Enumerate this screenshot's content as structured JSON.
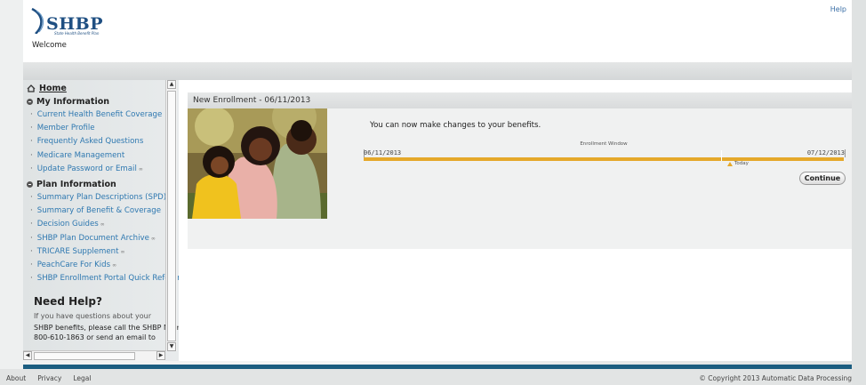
{
  "header": {
    "logo_text": "SHBP",
    "logo_subtitle": "State Health Benefit Plan",
    "welcome": "Welcome",
    "help": "Help"
  },
  "sidebar": {
    "home": "Home",
    "my_information": {
      "title": "My Information",
      "items": [
        {
          "label": "Current Health Benefit Coverage"
        },
        {
          "label": "Member Profile"
        },
        {
          "label": "Frequently Asked Questions"
        },
        {
          "label": "Medicare Management"
        },
        {
          "label": "Update Password or Email"
        }
      ]
    },
    "plan_information": {
      "title": "Plan Information",
      "items": [
        {
          "label": "Summary Plan Descriptions (SPD)"
        },
        {
          "label": "Summary of Benefit & Coverage"
        },
        {
          "label": "Decision Guides"
        },
        {
          "label": "SHBP Plan Document Archive"
        },
        {
          "label": "TRICARE Supplement"
        },
        {
          "label": "PeachCare For Kids"
        },
        {
          "label": "SHBP Enrollment Portal Quick Reference"
        }
      ]
    },
    "need_help": {
      "title": "Need Help?",
      "line1": "If you have questions about your",
      "line2": "SHBP benefits, please call the SHBP Member",
      "line3": "800-610-1863 or send an email to"
    }
  },
  "enrollment": {
    "panel_title": "New Enrollment - 06/11/2013",
    "message": "You can now make changes to your benefits.",
    "window_label": "Enrollment Window",
    "start_date": "06/11/2013",
    "end_date": "07/12/2013",
    "today_label": "Today",
    "continue_label": "Continue",
    "bar_color": "#e5a82a"
  },
  "footer": {
    "links": [
      "About",
      "Privacy",
      "Legal"
    ],
    "copyright": "© Copyright 2013 Automatic Data Processing"
  }
}
